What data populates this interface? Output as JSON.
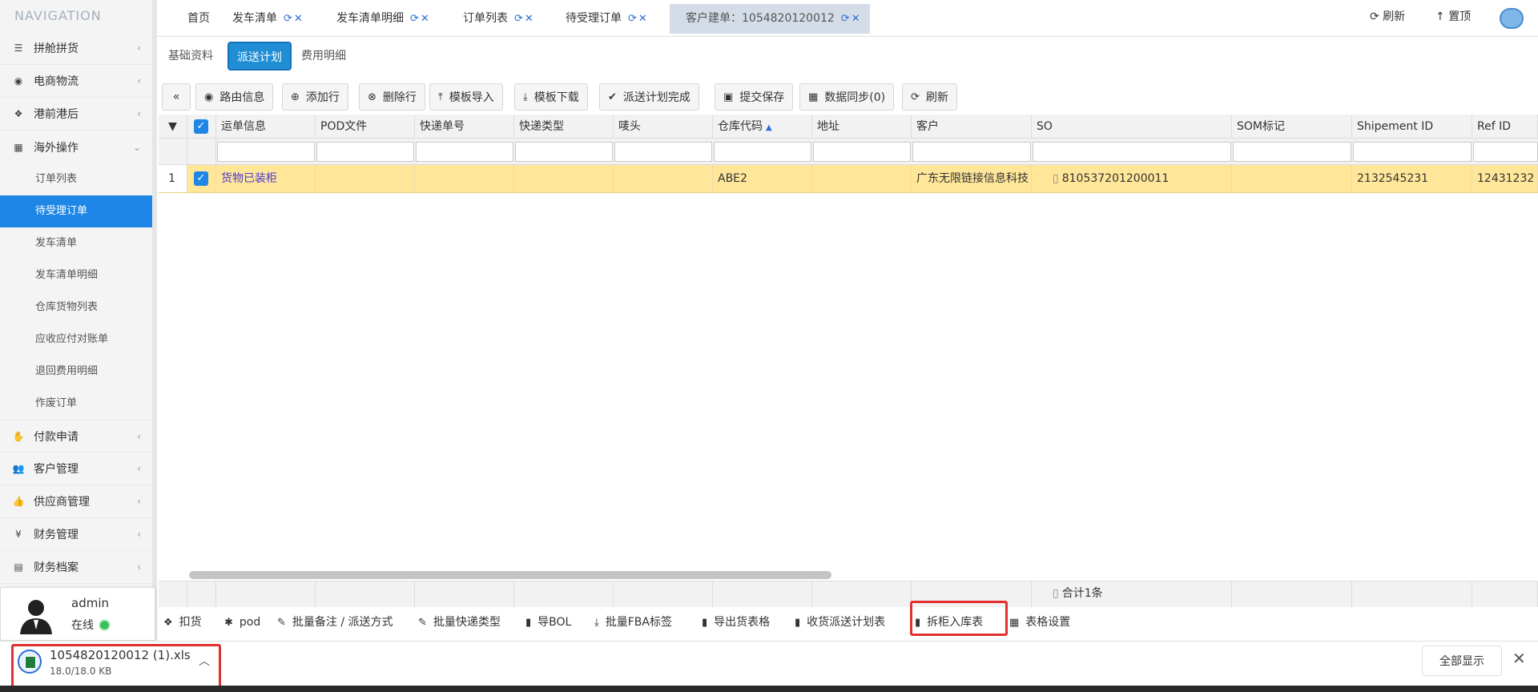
{
  "sidebar": {
    "title": "NAVIGATION",
    "items": [
      {
        "label": "拼舱拼货",
        "icon": "list-icon"
      },
      {
        "label": "电商物流",
        "icon": "globe-icon"
      },
      {
        "label": "港前港后",
        "icon": "cubes-icon"
      },
      {
        "label": "海外操作",
        "icon": "bank-icon"
      }
    ],
    "sub_items": [
      "订单列表",
      "待受理订单",
      "发车清单",
      "发车清单明细",
      "仓库货物列表",
      "应收应付对账单",
      "退回费用明细",
      "作废订单"
    ],
    "active_sub": "待受理订单",
    "items_after": [
      {
        "label": "付款申请",
        "icon": "handshake-icon"
      },
      {
        "label": "客户管理",
        "icon": "users-icon"
      },
      {
        "label": "供应商管理",
        "icon": "thumbs-up-icon"
      },
      {
        "label": "财务管理",
        "icon": "yen-icon"
      },
      {
        "label": "财务档案",
        "icon": "book-icon"
      }
    ]
  },
  "user": {
    "name": "admin",
    "status": "在线"
  },
  "tabs": [
    {
      "label": "首页"
    },
    {
      "label": "发车清单"
    },
    {
      "label": "发车清单明细"
    },
    {
      "label": "订单列表"
    },
    {
      "label": "待受理订单"
    },
    {
      "label": "客户建单：1054820120012"
    }
  ],
  "header": {
    "refresh": "刷新",
    "top": "置顶"
  },
  "subtabs": [
    "基础资料",
    "派送计划",
    "费用明细"
  ],
  "toolbar": {
    "collapse": "«",
    "buttons": [
      "路由信息",
      "添加行",
      "删除行",
      "模板导入",
      "模板下载",
      "派送计划完成",
      "提交保存",
      "数据同步(0)",
      "刷新"
    ]
  },
  "grid": {
    "columns": [
      "运单信息",
      "POD文件",
      "快递单号",
      "快递类型",
      "唛头",
      "仓库代码",
      "地址",
      "客户",
      "SO",
      "SOM标记",
      "Shipement ID",
      "Ref ID"
    ],
    "sorted_column": "仓库代码",
    "row": {
      "index": "1",
      "waybill": "货物已装柜",
      "warehouse": "ABE2",
      "customer": "广东无限链接信息科技",
      "so": "810537201200011",
      "shipment_id": "2132545231",
      "ref_id": "12431232"
    },
    "footer_total": "合计1条"
  },
  "actions": [
    "扣货",
    "pod",
    "批量备注 / 派送方式",
    "批量快递类型",
    "导BOL",
    "批量FBA标签",
    "导出货表格",
    "收货派送计划表",
    "拆柜入库表",
    "表格设置"
  ],
  "download": {
    "filename": "1054820120012 (1).xls",
    "size": "18.0/18.0 KB",
    "show_all": "全部显示",
    "close": "✕"
  }
}
